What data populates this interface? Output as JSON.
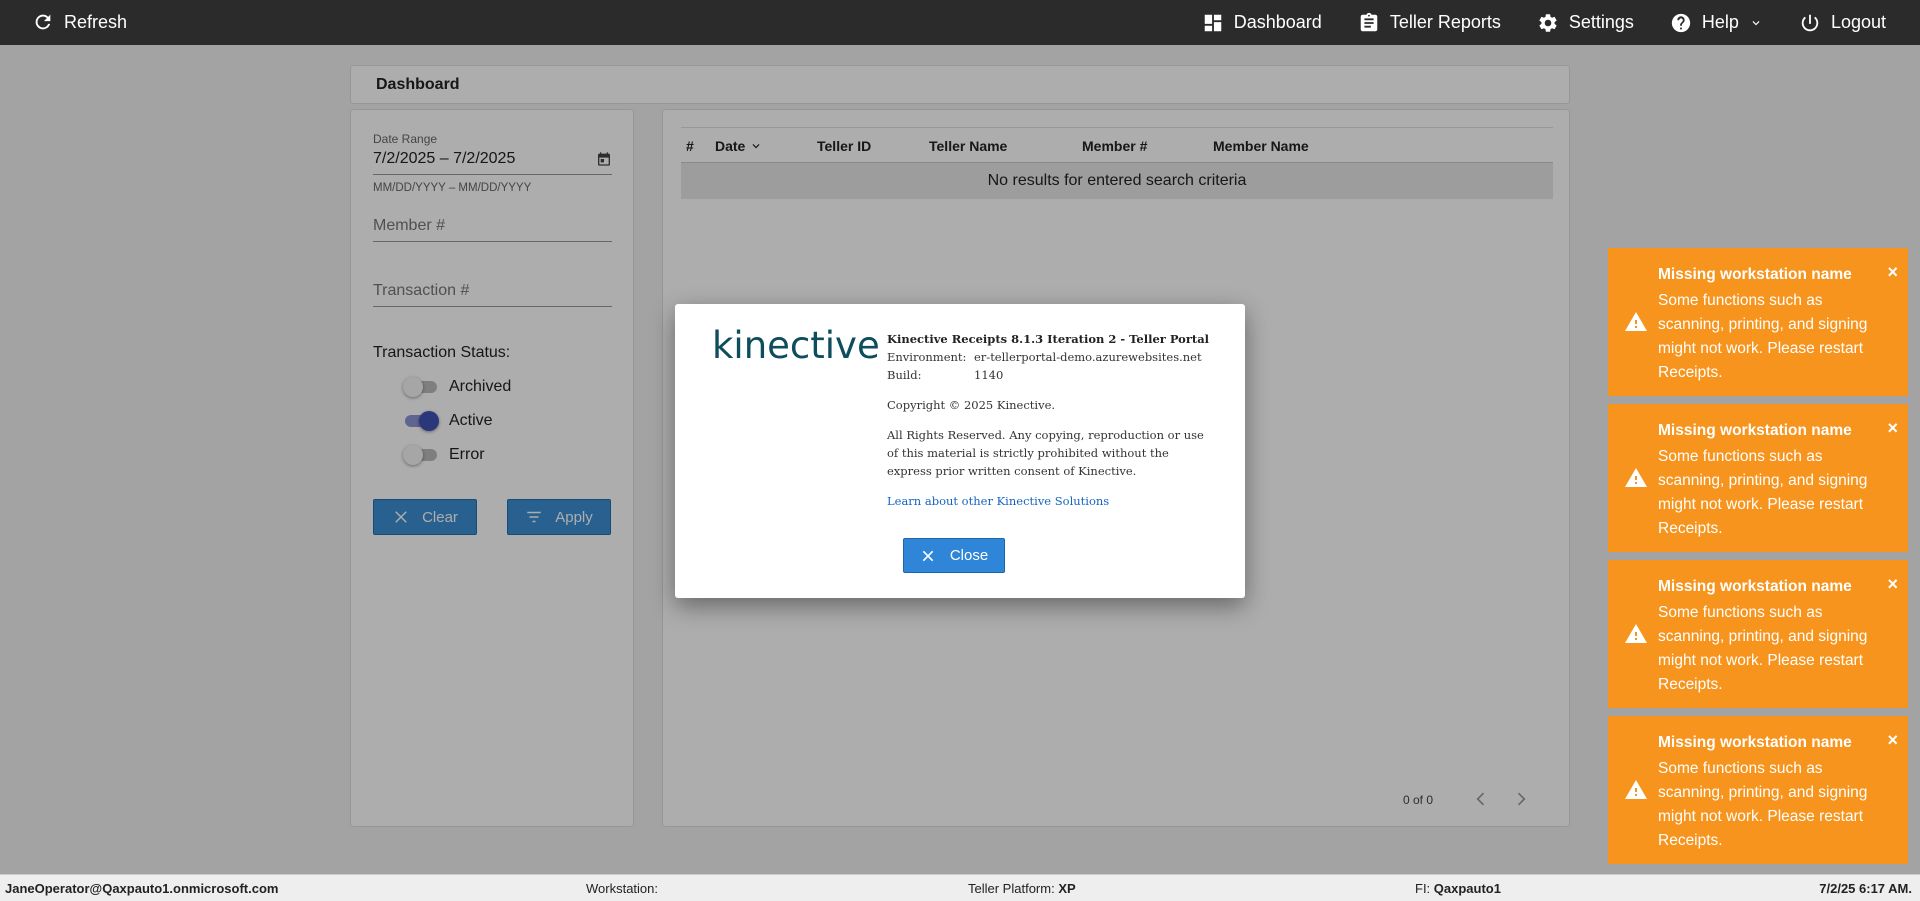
{
  "topbar": {
    "refresh": "Refresh",
    "nav": [
      {
        "label": "Dashboard",
        "icon": "dashboard-icon"
      },
      {
        "label": "Teller Reports",
        "icon": "clipboard-icon"
      },
      {
        "label": "Settings",
        "icon": "gear-icon"
      },
      {
        "label": "Help",
        "icon": "help-icon"
      },
      {
        "label": "Logout",
        "icon": "power-icon"
      }
    ]
  },
  "page_title": "Dashboard",
  "filters": {
    "date_range_label": "Date Range",
    "date_range_value": "7/2/2025 – 7/2/2025",
    "date_hint": "MM/DD/YYYY – MM/DD/YYYY",
    "member_placeholder": "Member #",
    "transaction_placeholder": "Transaction #",
    "status_label": "Transaction Status:",
    "statuses": [
      {
        "label": "Archived",
        "on": false
      },
      {
        "label": "Active",
        "on": true
      },
      {
        "label": "Error",
        "on": false
      }
    ],
    "clear_label": "Clear",
    "apply_label": "Apply"
  },
  "table": {
    "columns": [
      "#",
      "Date",
      "Teller ID",
      "Teller Name",
      "Member #",
      "Member Name"
    ],
    "empty_message": "No results for entered search criteria",
    "paginator": "0 of 0"
  },
  "modal": {
    "logo": "kinective",
    "title": "Kinective Receipts 8.1.3 Iteration 2 - Teller Portal",
    "environment_label": "Environment:",
    "environment_value": "er-tellerportal-demo.azurewebsites.net",
    "build_label": "Build:",
    "build_value": "1140",
    "copyright": "Copyright © 2025 Kinective.",
    "rights": "All Rights Reserved. Any copying, reproduction or use of this material is strictly prohibited without the express prior written consent of Kinective.",
    "link": "Learn about other Kinective Solutions",
    "close_label": "Close"
  },
  "toasts": [
    {
      "title": "Missing workstation name",
      "body": "Some functions such as scanning, printing, and signing might not work. Please restart Receipts.",
      "close": "×"
    },
    {
      "title": "Missing workstation name",
      "body": "Some functions such as scanning, printing, and signing might not work. Please restart Receipts.",
      "close": "×"
    },
    {
      "title": "Missing workstation name",
      "body": "Some functions such as scanning, printing, and signing might not work. Please restart Receipts.",
      "close": "×"
    },
    {
      "title": "Missing workstation name",
      "body": "Some functions such as scanning, printing, and signing might not work. Please restart Receipts.",
      "close": "×"
    }
  ],
  "statusbar": {
    "user": "JaneOperator@Qaxpauto1.onmicrosoft.com",
    "workstation_label": "Workstation:",
    "platform_label": "Teller Platform:",
    "platform_value": "XP",
    "fi_label": "FI:",
    "fi_value": "Qaxpauto1",
    "datetime": "7/2/25 6:17 AM."
  }
}
